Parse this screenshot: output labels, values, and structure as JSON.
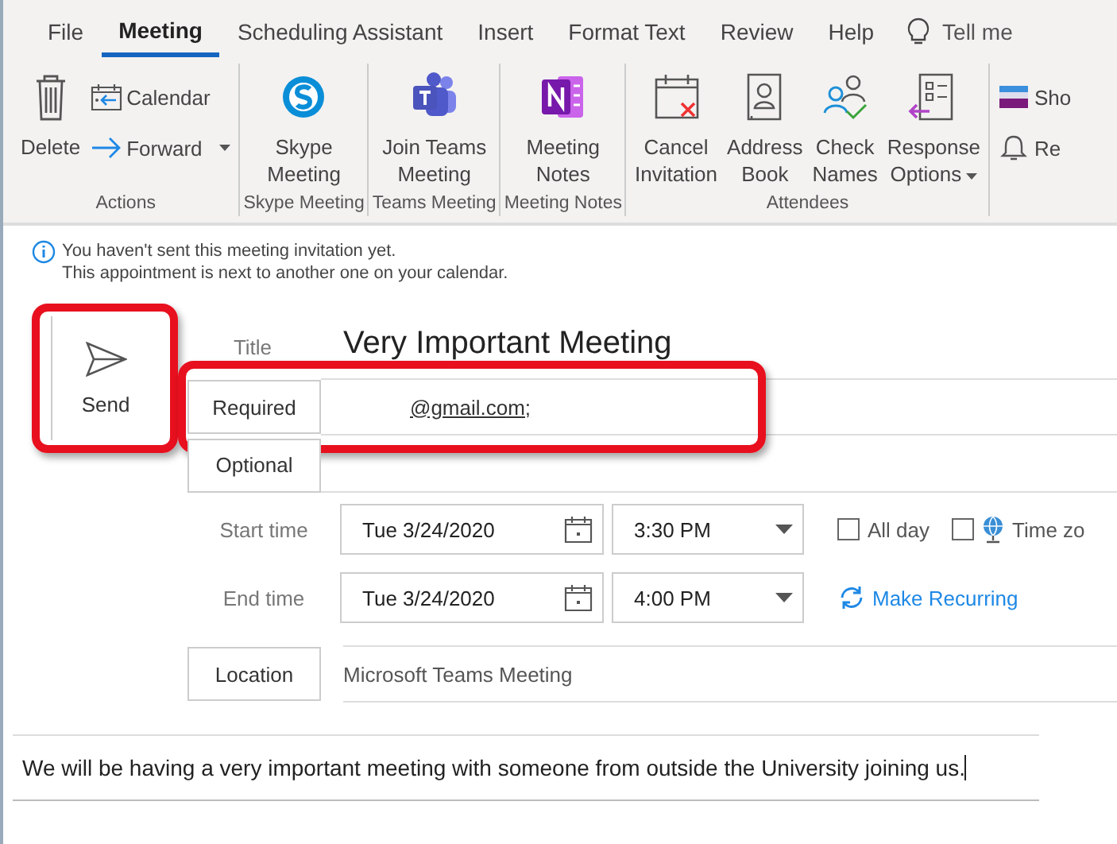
{
  "menu_tabs": [
    {
      "label": "File",
      "selected": false
    },
    {
      "label": "Meeting",
      "selected": true
    },
    {
      "label": "Scheduling Assistant",
      "selected": false
    },
    {
      "label": "Insert",
      "selected": false
    },
    {
      "label": "Format Text",
      "selected": false
    },
    {
      "label": "Review",
      "selected": false
    },
    {
      "label": "Help",
      "selected": false
    }
  ],
  "tell_me": "Tell me",
  "ribbon_groups": [
    {
      "name": "Actions",
      "buttons": [
        {
          "kind": "large",
          "label": [
            "Delete"
          ],
          "dropdown": false
        },
        {
          "kind": "small",
          "label": [
            "Calendar"
          ],
          "dropdown": false
        },
        {
          "kind": "small",
          "label": [
            "Forward"
          ],
          "dropdown": true
        }
      ]
    },
    {
      "name": "Skype Meeting",
      "buttons": [
        {
          "kind": "large",
          "label": [
            "Skype",
            "Meeting"
          ],
          "dropdown": false
        }
      ]
    },
    {
      "name": "Teams Meeting",
      "buttons": [
        {
          "kind": "large",
          "label": [
            "Join Teams",
            "Meeting"
          ],
          "dropdown": false
        }
      ]
    },
    {
      "name": "Meeting Notes",
      "buttons": [
        {
          "kind": "large",
          "label": [
            "Meeting",
            "Notes"
          ],
          "dropdown": false
        }
      ]
    },
    {
      "name": "Attendees",
      "buttons": [
        {
          "kind": "large",
          "label": [
            "Cancel",
            "Invitation"
          ],
          "dropdown": false
        },
        {
          "kind": "large",
          "label": [
            "Address",
            "Book"
          ],
          "dropdown": false
        },
        {
          "kind": "large",
          "label": [
            "Check",
            "Names"
          ],
          "dropdown": false
        },
        {
          "kind": "large",
          "label": [
            "Response",
            "Options"
          ],
          "dropdown": true
        }
      ]
    },
    {
      "buttons": [
        {
          "kind": "small",
          "label": [
            "Sho"
          ],
          "dropdown": false
        },
        {
          "kind": "small",
          "label": [
            "Re"
          ],
          "dropdown": false
        }
      ]
    }
  ],
  "info_messages": [
    "You haven't sent this meeting invitation yet.",
    "This appointment is next to another one on your calendar."
  ],
  "send_button": {
    "label": "Send",
    "highlighted": true
  },
  "title": {
    "label": "Title",
    "value": "Very Important Meeting"
  },
  "required": {
    "label": "Required",
    "value": "@gmail.com;",
    "highlighted": true
  },
  "optional": {
    "label": "Optional"
  },
  "start": {
    "label": "Start time",
    "date": "Tue 3/24/2020",
    "time": "3:30 PM"
  },
  "all_day": {
    "label": "All day",
    "checked": false
  },
  "time_zones": {
    "label": "Time zo",
    "checked": false
  },
  "end": {
    "label": "End time",
    "date": "Tue 3/24/2020",
    "time": "4:00 PM"
  },
  "make_recurring": "Make Recurring",
  "location": {
    "label": "Location",
    "value": "Microsoft Teams Meeting"
  },
  "body": "We will be having a very important meeting with someone from outside the University joining us."
}
